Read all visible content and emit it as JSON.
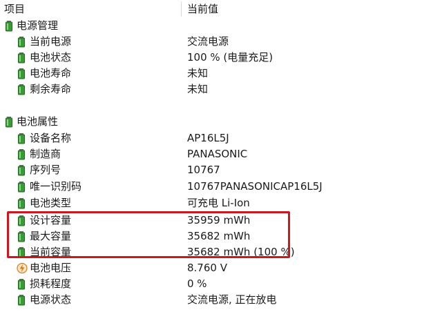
{
  "header": {
    "col_item": "项目",
    "col_value": "当前值"
  },
  "colors": {
    "battery_green": "#3a9a35",
    "highlight_red": "#d0161d",
    "voltage_orange": "#e07a10"
  },
  "groups": [
    {
      "label": "电源管理",
      "icon": "battery-icon",
      "items": [
        {
          "label": "当前电源",
          "value": "交流电源",
          "icon": "battery-icon"
        },
        {
          "label": "电池状态",
          "value": "100 % (电量充足)",
          "icon": "battery-icon"
        },
        {
          "label": "电池寿命",
          "value": "未知",
          "icon": "battery-icon"
        },
        {
          "label": "剩余寿命",
          "value": "未知",
          "icon": "battery-icon"
        }
      ]
    },
    {
      "label": "电池属性",
      "icon": "battery-icon",
      "items": [
        {
          "label": "设备名称",
          "value": "AP16L5J",
          "icon": "battery-icon"
        },
        {
          "label": "制造商",
          "value": "PANASONIC",
          "icon": "battery-icon"
        },
        {
          "label": "序列号",
          "value": "10767",
          "icon": "battery-icon"
        },
        {
          "label": "唯一识别码",
          "value": "10767PANASONICAP16L5J",
          "icon": "battery-icon"
        },
        {
          "label": "电池类型",
          "value": "可充电 Li-Ion",
          "icon": "battery-icon"
        },
        {
          "label": "设计容量",
          "value": "35959 mWh",
          "icon": "battery-icon"
        },
        {
          "label": "最大容量",
          "value": "35682 mWh",
          "icon": "battery-icon"
        },
        {
          "label": "当前容量",
          "value": "35682 mWh  (100 %)",
          "icon": "battery-icon"
        },
        {
          "label": "电池电压",
          "value": "8.760 V",
          "icon": "voltage-icon"
        },
        {
          "label": "损耗程度",
          "value": "0 %",
          "icon": "battery-icon"
        },
        {
          "label": "电源状态",
          "value": "交流电源, 正在放电",
          "icon": "battery-icon"
        }
      ]
    }
  ]
}
